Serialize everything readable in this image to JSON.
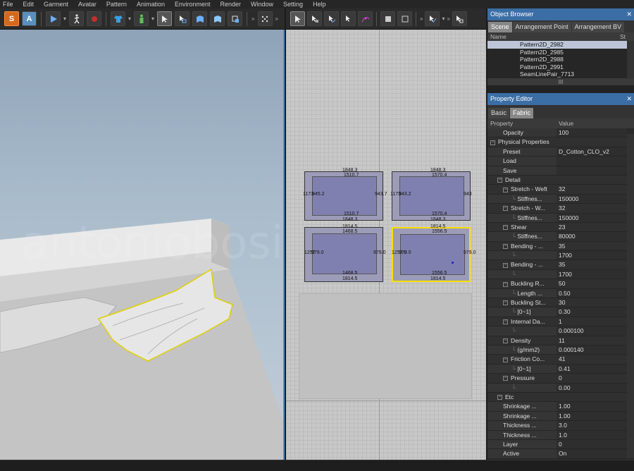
{
  "menu": [
    "File",
    "Edit",
    "Garment",
    "Avatar",
    "Pattern",
    "Animation",
    "Environment",
    "Render",
    "Window",
    "Setting",
    "Help"
  ],
  "toolbar": {
    "s_label": "S",
    "a_label": "A",
    "more": "»"
  },
  "watermark": "antoniobosi.com",
  "patterns": {
    "p1": {
      "top": "1848.3",
      "top_inner": "1510.7",
      "left": "1173",
      "left_inner": "945.2",
      "right": "943.7",
      "right2": "173",
      "bottom_inner": "1510.7",
      "bottom": "1848.3"
    },
    "p2": {
      "top": "1848.3",
      "top_inner": "1570.4",
      "left": "1173",
      "left_inner": "943.2",
      "right": "943",
      "right2": "173.5",
      "bottom_inner": "1570.4",
      "bottom": "1848.3"
    },
    "p3": {
      "top": "1814.5",
      "top_inner": "1468.5",
      "left": "1257",
      "left_inner": "979.0",
      "right": "979.0",
      "right2": "257.0",
      "bottom_inner": "1468.5",
      "bottom": "1814.5"
    },
    "p4": {
      "top": "1814.5",
      "top_inner": "1556.5",
      "left": "1257.0",
      "left_inner": "979.0",
      "right": "979.0",
      "right2": "257.5",
      "bottom_inner": "1556.5",
      "bottom": "1814.5"
    }
  },
  "object_browser": {
    "title": "Object Browser",
    "tabs": [
      "Scene",
      "Arrangement Point",
      "Arrangement BV"
    ],
    "col_name": "Name",
    "col_st": "St",
    "items": [
      "Pattern2D_2982",
      "Pattern2D_2985",
      "Pattern2D_2988",
      "Pattern2D_2991",
      "SeamLinePair_7713"
    ],
    "scroll_mark": "III"
  },
  "property_editor": {
    "title": "Property Editor",
    "tabs": [
      "Basic",
      "Fabric"
    ],
    "col_property": "Property",
    "col_value": "Value",
    "rows": [
      {
        "k": "Opacity",
        "v": "100",
        "indent": 2,
        "toggle": ""
      },
      {
        "k": "Physical Properties",
        "v": "",
        "indent": 0,
        "toggle": "−"
      },
      {
        "k": "Preset",
        "v": "D_Cotton_CLO_v2",
        "indent": 2,
        "toggle": ""
      },
      {
        "k": "Load",
        "v": "",
        "indent": 2,
        "toggle": ""
      },
      {
        "k": "Save",
        "v": "",
        "indent": 2,
        "toggle": ""
      },
      {
        "k": "Detail",
        "v": "",
        "indent": 1,
        "toggle": "−"
      },
      {
        "k": "Stretch - Weft",
        "v": "32",
        "indent": 2,
        "toggle": "−"
      },
      {
        "k": "Stiffnes...",
        "v": "150000",
        "indent": 3,
        "toggle": ""
      },
      {
        "k": "Stretch - W...",
        "v": "32",
        "indent": 2,
        "toggle": "−"
      },
      {
        "k": "Stiffnes...",
        "v": "150000",
        "indent": 3,
        "toggle": ""
      },
      {
        "k": "Shear",
        "v": "23",
        "indent": 2,
        "toggle": "−"
      },
      {
        "k": "Stiffnes...",
        "v": "80000",
        "indent": 3,
        "toggle": ""
      },
      {
        "k": "Bending - ...",
        "v": "35",
        "indent": 2,
        "toggle": "−"
      },
      {
        "k": "",
        "v": "1700",
        "indent": 3,
        "toggle": ""
      },
      {
        "k": "Bending - ...",
        "v": "35",
        "indent": 2,
        "toggle": "−"
      },
      {
        "k": "",
        "v": "1700",
        "indent": 3,
        "toggle": ""
      },
      {
        "k": "Buckling R...",
        "v": "50",
        "indent": 2,
        "toggle": "−"
      },
      {
        "k": "Length ...",
        "v": "0.50",
        "indent": 3,
        "toggle": ""
      },
      {
        "k": "Buckling St...",
        "v": "30",
        "indent": 2,
        "toggle": "−"
      },
      {
        "k": "[0~1]",
        "v": "0.30",
        "indent": 3,
        "toggle": ""
      },
      {
        "k": "Internal Da...",
        "v": "1",
        "indent": 2,
        "toggle": "−"
      },
      {
        "k": "",
        "v": "0.000100",
        "indent": 3,
        "toggle": ""
      },
      {
        "k": "Density",
        "v": "11",
        "indent": 2,
        "toggle": "−"
      },
      {
        "k": "(g/mm2)",
        "v": "0.000140",
        "indent": 3,
        "toggle": ""
      },
      {
        "k": "Friction Co...",
        "v": "41",
        "indent": 2,
        "toggle": "−"
      },
      {
        "k": "[0~1]",
        "v": "0.41",
        "indent": 3,
        "toggle": ""
      },
      {
        "k": "Pressure",
        "v": "0",
        "indent": 2,
        "toggle": "−"
      },
      {
        "k": "",
        "v": "0.00",
        "indent": 3,
        "toggle": ""
      },
      {
        "k": "Etc",
        "v": "",
        "indent": 1,
        "toggle": "−"
      },
      {
        "k": "Shrinkage ...",
        "v": "1.00",
        "indent": 2,
        "toggle": ""
      },
      {
        "k": "Shrinkage ...",
        "v": "1.00",
        "indent": 2,
        "toggle": ""
      },
      {
        "k": "Thickness ...",
        "v": "3.0",
        "indent": 2,
        "toggle": ""
      },
      {
        "k": "Thickness ...",
        "v": "1.0",
        "indent": 2,
        "toggle": ""
      },
      {
        "k": "Layer",
        "v": "0",
        "indent": 2,
        "toggle": ""
      },
      {
        "k": "Active",
        "v": "On",
        "indent": 2,
        "toggle": ""
      }
    ]
  }
}
